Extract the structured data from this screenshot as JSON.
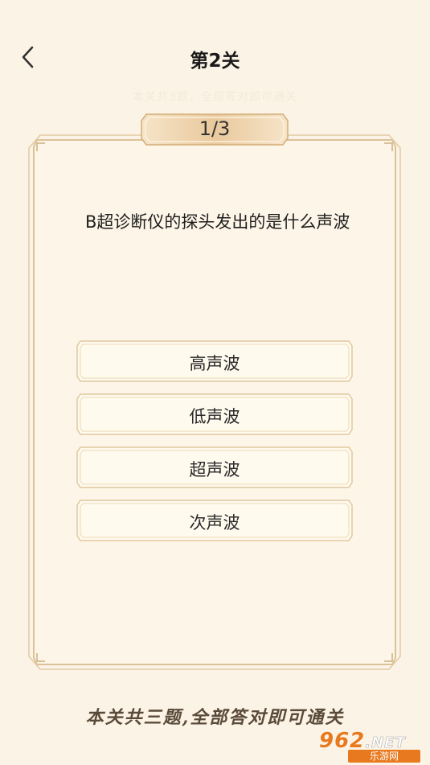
{
  "header": {
    "title": "第2关",
    "subtitle": "本关共3题，全部答对即可通关"
  },
  "progress": {
    "label": "1/3",
    "current": 1,
    "total": 3
  },
  "question": {
    "text": "B超诊断仪的探头发出的是什么声波"
  },
  "options": [
    {
      "label": "高声波"
    },
    {
      "label": "低声波"
    },
    {
      "label": "超声波"
    },
    {
      "label": "次声波"
    }
  ],
  "footer": {
    "note": "本关共三题,全部答对即可通关"
  },
  "watermark": {
    "logo": "962",
    "domain": ".NET",
    "site_name": "乐游网"
  },
  "colors": {
    "background": "#fbf4e6",
    "card_fill": "#fdf6e8",
    "frame_gold": "#d9b98a",
    "badge_gold": "#e7c9a0"
  }
}
